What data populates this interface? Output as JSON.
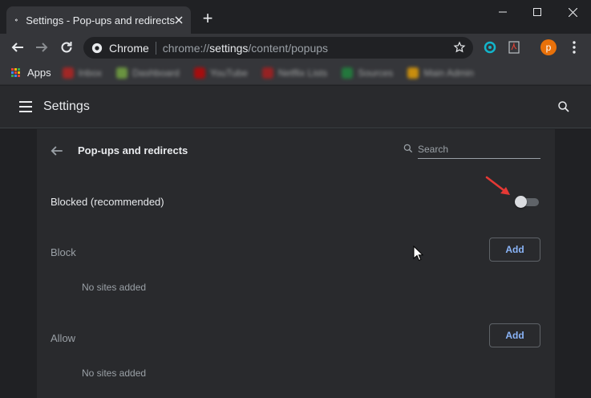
{
  "tab": {
    "title": "Settings - Pop-ups and redirects",
    "icon": "gear-icon",
    "close_icon": "close-icon"
  },
  "new_tab_label": "+",
  "window_controls": [
    "minimize-icon",
    "maximize-icon",
    "close-icon"
  ],
  "toolbar": {
    "site_label": "Chrome",
    "url_prefix": "chrome://",
    "url_host": "settings",
    "url_path": "/content/popups",
    "avatar_letter": "p"
  },
  "bookmarks": {
    "apps_label": "Apps",
    "apps_colors": [
      "#ea4335",
      "#fbbc04",
      "#34a853",
      "#4285f4",
      "#ea4335",
      "#fbbc04",
      "#34a853",
      "#4285f4",
      "#ea4335"
    ],
    "items": [
      {
        "label": "Inbox",
        "color": "#c5221f"
      },
      {
        "label": "Dashboard",
        "color": "#7cb342"
      },
      {
        "label": "YouTube",
        "color": "#cc0000"
      },
      {
        "label": "Netflix Lists",
        "color": "#b71c1c"
      },
      {
        "label": "Sources",
        "color": "#1e8e3e"
      },
      {
        "label": "Main Admin",
        "color": "#f9ab00"
      }
    ]
  },
  "settings": {
    "title": "Settings",
    "menu_icon": "hamburger-icon",
    "search_icon": "search-icon"
  },
  "popups": {
    "title": "Pop-ups and redirects",
    "search_placeholder": "Search",
    "blocked_label": "Blocked (recommended)",
    "blocked_toggle_on": false,
    "block_section": "Block",
    "block_add": "Add",
    "block_empty": "No sites added",
    "allow_section": "Allow",
    "allow_add": "Add",
    "allow_empty": "No sites added"
  },
  "colors": {
    "accent": "#8ab4f8",
    "annotation_arrow": "#e53935"
  }
}
